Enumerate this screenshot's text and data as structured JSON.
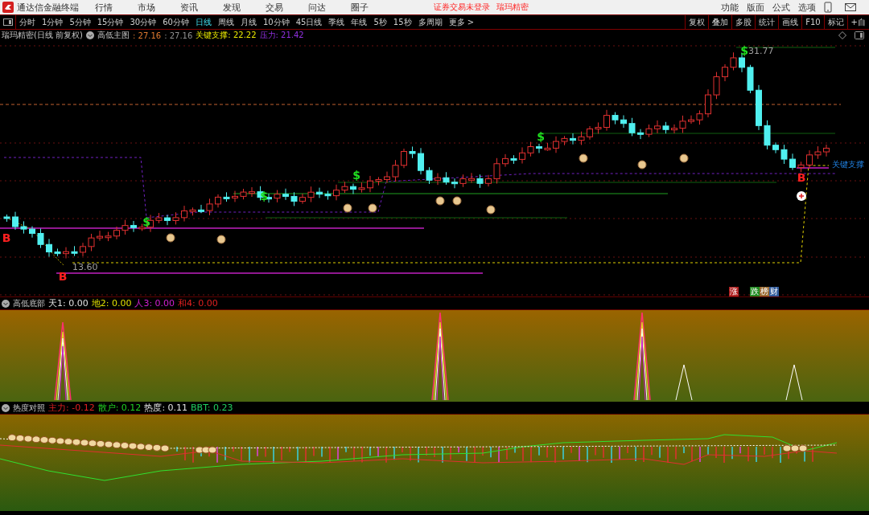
{
  "app": {
    "name": "通达信金融终端"
  },
  "menu": [
    "行情",
    "市场",
    "资讯",
    "发现",
    "交易",
    "问达",
    "圈子"
  ],
  "status_notices": [
    "证券交易未登录",
    "瑞玛精密"
  ],
  "right_menu": [
    "功能",
    "版面",
    "公式",
    "选项"
  ],
  "periods": [
    {
      "label": "分时",
      "selected": false
    },
    {
      "label": "1分钟",
      "selected": false
    },
    {
      "label": "5分钟",
      "selected": false
    },
    {
      "label": "15分钟",
      "selected": false
    },
    {
      "label": "30分钟",
      "selected": false
    },
    {
      "label": "60分钟",
      "selected": false
    },
    {
      "label": "日线",
      "selected": true
    },
    {
      "label": "周线",
      "selected": false
    },
    {
      "label": "月线",
      "selected": false
    },
    {
      "label": "10分钟",
      "selected": false
    },
    {
      "label": "45日线",
      "selected": false
    },
    {
      "label": "季线",
      "selected": false
    },
    {
      "label": "年线",
      "selected": false
    },
    {
      "label": "5秒",
      "selected": false
    },
    {
      "label": "15秒",
      "selected": false
    },
    {
      "label": "多周期",
      "selected": false
    },
    {
      "label": "更多 >",
      "selected": false
    }
  ],
  "tools": [
    "复权",
    "叠加",
    "多股",
    "统计",
    "画线",
    "F10",
    "标记",
    "+自"
  ],
  "main_chart": {
    "stock": "瑞玛精密(日线 前复权)",
    "indicator": "高低主图",
    "values": [
      {
        "text": ": 27.16",
        "color": "#e07a30"
      },
      {
        "text": ": 27.16",
        "color": "#909090"
      },
      {
        "text": "关键支撑: 22.22",
        "color": "#e8e800"
      },
      {
        "text": "压力: 21.42",
        "color": "#9030e0"
      }
    ],
    "high_label": "31.77",
    "low_label": "13.60",
    "support_label": "关键支撑",
    "signals": [
      {
        "kind": "buy",
        "text": "B"
      },
      {
        "kind": "buy",
        "text": "B"
      },
      {
        "kind": "buy",
        "text": "B"
      },
      {
        "kind": "sell",
        "text": "$"
      },
      {
        "kind": "sell",
        "text": "$"
      },
      {
        "kind": "sell",
        "text": "$"
      },
      {
        "kind": "sell",
        "text": "$"
      },
      {
        "kind": "sell",
        "text": "$"
      }
    ],
    "badges": [
      {
        "text": "涨",
        "color": "#b02020"
      },
      {
        "text": "跌",
        "color": "#208a20"
      },
      {
        "text": "榜",
        "color": "#9a6a30"
      },
      {
        "text": "财",
        "color": "#305a9a"
      }
    ]
  },
  "panels": [
    {
      "title": "高低底部",
      "values": [
        {
          "text": "天1: 0.00",
          "color": "#e0e0e0"
        },
        {
          "text": "地2: 0.00",
          "color": "#e0e000"
        },
        {
          "text": "人3: 0.00",
          "color": "#d020d0"
        },
        {
          "text": "和4: 0.00",
          "color": "#e02020"
        }
      ]
    },
    {
      "title": "热度对照",
      "values": [
        {
          "text": "主力: -0.12",
          "kind": "main"
        },
        {
          "text": "散户: 0.12",
          "kind": "retail"
        },
        {
          "text": "热度: 0.11",
          "kind": "heat"
        },
        {
          "text": "BBT: 0.23",
          "kind": "bbt"
        }
      ]
    }
  ]
}
